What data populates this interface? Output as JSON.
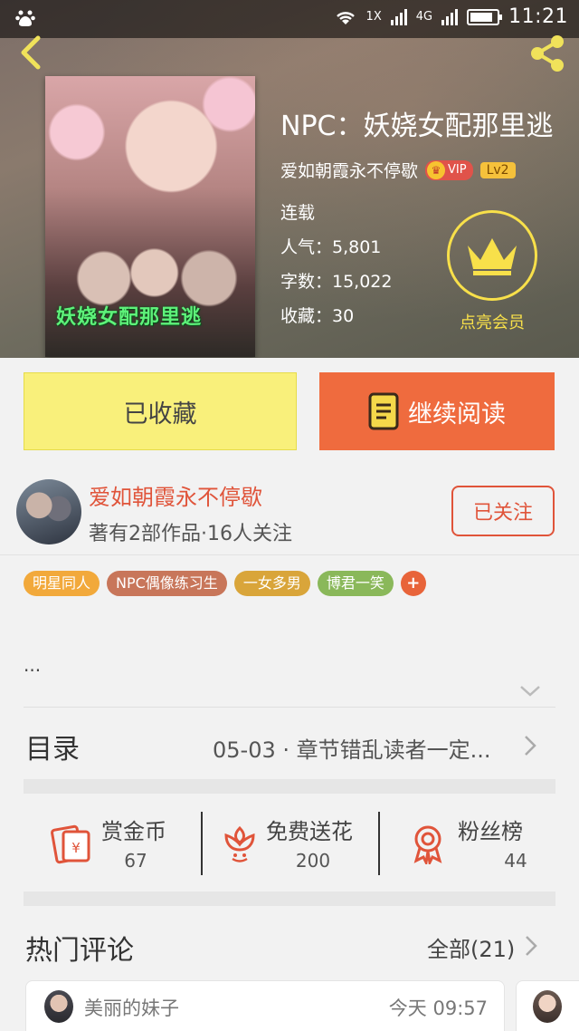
{
  "status_bar": {
    "network_1": "1X",
    "network_2": "4G",
    "time": "11:21"
  },
  "book": {
    "title": "NPC：妖娆女配那里逃",
    "cover_caption": "妖娆女配那里逃",
    "author": "爱如朝霞永不停歇",
    "vip_label": "VIP",
    "level": "Lv2",
    "status": "连载",
    "popularity": "人气：5,801",
    "word_count": "字数：15,022",
    "favorites": "收藏：30",
    "member_label": "点亮会员"
  },
  "actions": {
    "collected_label": "已收藏",
    "continue_label": "继续阅读"
  },
  "author_card": {
    "name": "爱如朝霞永不停歇",
    "meta": "著有2部作品·16人关注",
    "follow_label": "已关注"
  },
  "tags": [
    {
      "label": "明星同人",
      "color": "#f2a93b"
    },
    {
      "label": "NPC偶像练习生",
      "color": "#c8765a"
    },
    {
      "label": "一女多男",
      "color": "#d9a53a"
    },
    {
      "label": "博君一笑",
      "color": "#8ab85a"
    },
    {
      "label": "+",
      "color": "#e8643a"
    }
  ],
  "intro": {
    "text": "..."
  },
  "catalog": {
    "label": "目录",
    "latest": "05-03 · 章节错乱读者一定..."
  },
  "stats": [
    {
      "label": "赏金币",
      "value": "67",
      "icon": "red-envelope-icon"
    },
    {
      "label": "免费送花",
      "value": "200",
      "icon": "flower-icon"
    },
    {
      "label": "粉丝榜",
      "value": "44",
      "icon": "award-ribbon-icon"
    }
  ],
  "comments": {
    "title": "热门评论",
    "all_label": "全部(21)",
    "items": [
      {
        "user": "美丽的妹子",
        "time": "今天 09:57"
      }
    ]
  },
  "colors": {
    "accent_orange": "#ef6b3e",
    "collected_yellow": "#f9f07b",
    "author_red": "#e0543a",
    "member_gold": "#f8e04a"
  }
}
